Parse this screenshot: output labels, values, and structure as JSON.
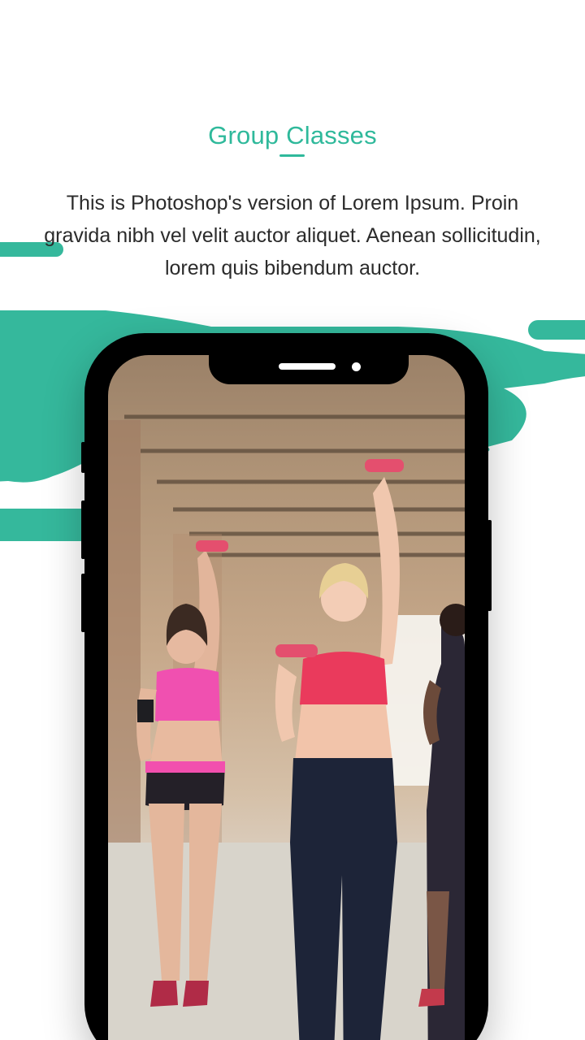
{
  "header": {
    "title": "Group Classes",
    "description": "This is Photoshop's version  of Lorem Ipsum. Proin gravida nibh vel velit auctor aliquet. Aenean sollicitudin, lorem quis bibendum auctor."
  },
  "colors": {
    "accent": "#2fb99b",
    "blob": "#35b89c",
    "text": "#2b2b2b",
    "phone": "#000000"
  },
  "phone": {
    "photo_subject": "women-with-dumbbells-workout-icon"
  }
}
